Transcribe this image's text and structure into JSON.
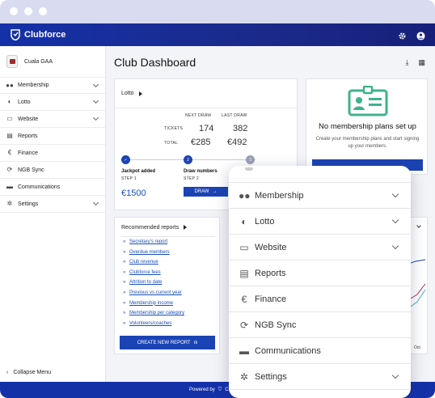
{
  "browser": {
    "dots": 3
  },
  "topbar": {
    "brand": "Clubforce",
    "icons": [
      "gear-icon",
      "user-icon"
    ]
  },
  "sidebar": {
    "club_name": "Cuala GAA",
    "items": [
      {
        "label": "Membership",
        "icon": "people-icon",
        "has_chevron": true
      },
      {
        "label": "Lotto",
        "icon": "toggle-icon",
        "has_chevron": true
      },
      {
        "label": "Website",
        "icon": "browser-icon",
        "has_chevron": true
      },
      {
        "label": "Reports",
        "icon": "report-icon",
        "has_chevron": false
      },
      {
        "label": "Finance",
        "icon": "euro-icon",
        "has_chevron": false
      },
      {
        "label": "NGB Sync",
        "icon": "sync-icon",
        "has_chevron": false
      },
      {
        "label": "Communications",
        "icon": "chat-icon",
        "has_chevron": false
      },
      {
        "label": "Settings",
        "icon": "gear-icon",
        "has_chevron": true
      }
    ],
    "collapse_label": "Collapse Menu"
  },
  "page": {
    "title": "Club Dashboard"
  },
  "lotto": {
    "title": "Lotto",
    "next_draw": "NEXT DRAW",
    "last_draw": "LAST DRAW",
    "tickets_label": "TICKETS",
    "total_label": "TOTAL",
    "next_tickets": "174",
    "last_tickets": "382",
    "next_total": "€285",
    "last_total": "€492",
    "step1_title": "Jackpot added",
    "step1_sub": "STEP 1",
    "step2_title": "Draw numbers",
    "step2_sub": "STEP 2",
    "step2_num": "2",
    "step3_num": "3",
    "jackpot": "€1500",
    "draw_button": "DRAW"
  },
  "membership_card": {
    "title": "No membership plans set up",
    "text": "Create your membership plans and start signing up your members."
  },
  "reports": {
    "title": "Recommended reports",
    "links": [
      "Secretary's report",
      "Overdue members",
      "Club revenue",
      "Clubforce fees",
      "Attrition to date",
      "Previous vs current year",
      "Membership income",
      "Membership per category",
      "Volunteers/coaches"
    ],
    "button": "CREATE NEW REPORT"
  },
  "chart_stub": {
    "axis_label": "Oct"
  },
  "footer": {
    "powered_by": "Powered by",
    "brand": "Clubforce"
  },
  "popup_menu": {
    "items": [
      {
        "label": "Membership",
        "icon": "people-icon",
        "has_chevron": true
      },
      {
        "label": "Lotto",
        "icon": "toggle-icon",
        "has_chevron": true
      },
      {
        "label": "Website",
        "icon": "browser-icon",
        "has_chevron": true
      },
      {
        "label": "Reports",
        "icon": "report-icon",
        "has_chevron": false
      },
      {
        "label": "Finance",
        "icon": "euro-icon",
        "has_chevron": false
      },
      {
        "label": "NGB Sync",
        "icon": "sync-icon",
        "has_chevron": false
      },
      {
        "label": "Communications",
        "icon": "chat-icon",
        "has_chevron": false
      },
      {
        "label": "Settings",
        "icon": "gear-icon",
        "has_chevron": true
      }
    ]
  },
  "colors": {
    "brand": "#1b43b4",
    "membership_icon": "#3fb28c"
  }
}
